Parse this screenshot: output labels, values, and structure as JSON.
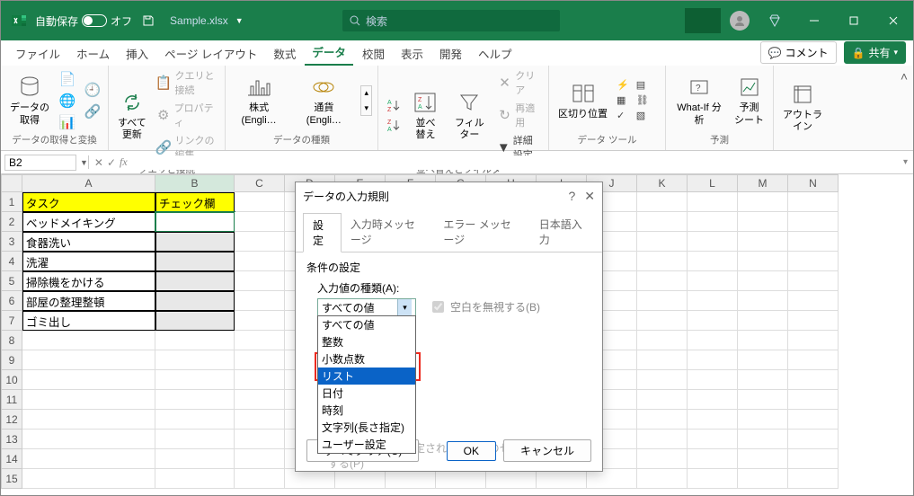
{
  "titlebar": {
    "autosave_label": "自動保存",
    "autosave_state": "オフ",
    "filename": "Sample.xlsx",
    "search_placeholder": "検索"
  },
  "tabs": {
    "file": "ファイル",
    "home": "ホーム",
    "insert": "挿入",
    "page_layout": "ページ レイアウト",
    "formulas": "数式",
    "data": "データ",
    "review": "校閲",
    "view": "表示",
    "developer": "開発",
    "help": "ヘルプ",
    "comments": "コメント",
    "share": "共有"
  },
  "ribbon": {
    "get_data_btn": "データの\n取得",
    "get_data_group": "データの取得と変換",
    "refresh_all": "すべて\n更新",
    "queries_conn": "クエリと接続",
    "properties": "プロパティ",
    "edit_links": "リンクの編集",
    "queries_group": "クエリと接続",
    "stocks": "株式 (Engli…",
    "currency": "通貨 (Engli…",
    "data_types_group": "データの種類",
    "sort": "並べ替え",
    "filter": "フィルター",
    "clear": "クリア",
    "reapply": "再適用",
    "advanced": "詳細設定",
    "sort_filter_group": "並べ替えとフィルター",
    "text_to_cols": "区切り位置",
    "data_tools_group": "データ ツール",
    "whatif": "What-If 分析",
    "forecast_sheet": "予測\nシート",
    "forecast_group": "予測",
    "outline": "アウトラ\nイン"
  },
  "namebox": {
    "ref": "B2"
  },
  "sheet": {
    "cols": [
      "A",
      "B",
      "C",
      "D",
      "E",
      "F",
      "G",
      "H",
      "I",
      "J",
      "K",
      "L",
      "M",
      "N"
    ],
    "header": {
      "a": "タスク",
      "b": "チェック欄"
    },
    "rows": [
      "ベッドメイキング",
      "食器洗い",
      "洗濯",
      "掃除機をかける",
      "部屋の整理整頓",
      "ゴミ出し"
    ]
  },
  "dialog": {
    "title": "データの入力規則",
    "tab_settings": "設定",
    "tab_input_msg": "入力時メッセージ",
    "tab_error_msg": "エラー メッセージ",
    "tab_ime": "日本語入力",
    "section_label": "条件の設定",
    "allow_label": "入力値の種類(A):",
    "allow_value": "すべての値",
    "ignore_blank": "空白を無視する(B)",
    "options": {
      "all": "すべての値",
      "whole": "整数",
      "decimal": "小数点数",
      "list": "リスト",
      "date": "日付",
      "time": "時刻",
      "textlen": "文字列(長さ指定)",
      "custom": "ユーザー設定"
    },
    "apply_all": "同じ入力規則が設定されたすべてのセルに変更を適用する(P)",
    "clear_all": "すべてクリア(C)",
    "ok": "OK",
    "cancel": "キャンセル"
  }
}
